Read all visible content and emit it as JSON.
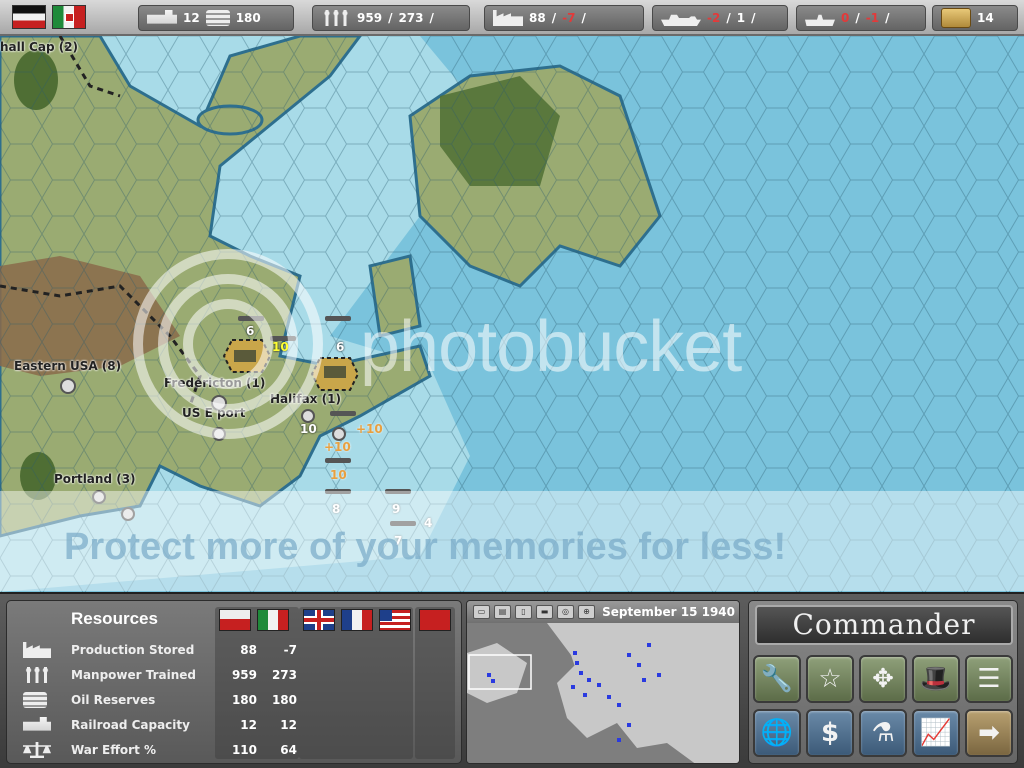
{
  "topbar": {
    "rail": "12",
    "oil": "180",
    "manpower": "959",
    "manpower_sep": "/",
    "manpower2": "273",
    "manpower_sep2": "/",
    "production": "88",
    "production_sep": "/",
    "production_delta": "-7",
    "production_sep2": "/",
    "naval": "-2",
    "naval_sep": "/",
    "naval2": "1",
    "naval_sep2": "/",
    "sub": "0",
    "sub_sep": "/",
    "sub2": "-1",
    "sub_sep2": "/",
    "treasure": "14",
    "icons": [
      "train-icon",
      "oil-barrels-icon",
      "manpower-icon",
      "factory-icon",
      "battleship-icon",
      "submarine-icon",
      "treasure-chest-icon"
    ]
  },
  "map": {
    "labels": [
      {
        "id": "hall-cap",
        "text": "hall Cap (2)"
      },
      {
        "id": "eastern-usa",
        "text": "Eastern USA (8)"
      },
      {
        "id": "fredericton",
        "text": "Fredericton (1)"
      },
      {
        "id": "us-east",
        "text": "US E port"
      },
      {
        "id": "halifax",
        "text": "Halifax (1)"
      },
      {
        "id": "portland",
        "text": "Portland (3)"
      }
    ],
    "unit_numbers": [
      "6",
      "10",
      "6",
      "10",
      "10",
      "+10",
      "+10",
      "8",
      "9",
      "4",
      "7"
    ],
    "watermark_logo": "photobucket",
    "watermark_text": "Protect more of your memories for less!"
  },
  "resources": {
    "title": "Resources",
    "rows": [
      {
        "label": "Production Stored",
        "v1": "88",
        "v2": "-7",
        "icon": "factory-icon"
      },
      {
        "label": "Manpower Trained",
        "v1": "959",
        "v2": "273",
        "icon": "manpower-icon"
      },
      {
        "label": "Oil Reserves",
        "v1": "180",
        "v2": "180",
        "icon": "oil-barrels-icon"
      },
      {
        "label": "Railroad Capacity",
        "v1": "12",
        "v2": "12",
        "icon": "train-icon"
      },
      {
        "label": "War Effort %",
        "v1": "110",
        "v2": "64",
        "icon": "scales-icon"
      }
    ],
    "flags": [
      "germany",
      "italy",
      "united-kingdom",
      "france",
      "united-states",
      "soviet-union"
    ]
  },
  "minimap": {
    "date": "September 15 1940",
    "tabs": [
      "map-tab",
      "list-tab",
      "unit-tab",
      "ship-tab",
      "target-tab",
      "zoom-tab"
    ]
  },
  "commander": {
    "title": "Commander",
    "buttons": [
      {
        "id": "repair",
        "icon": "wrench-icon",
        "glyph": "🔧"
      },
      {
        "id": "promote",
        "icon": "star-icon",
        "glyph": "☆"
      },
      {
        "id": "move",
        "icon": "move-arrows-icon",
        "glyph": "✥"
      },
      {
        "id": "diplomacy",
        "icon": "top-hat-icon",
        "glyph": "🎩"
      },
      {
        "id": "reports",
        "icon": "list-icon",
        "glyph": "☰"
      },
      {
        "id": "world",
        "icon": "globe-icon",
        "glyph": "🌐"
      },
      {
        "id": "economy",
        "icon": "dollar-icon",
        "glyph": "$"
      },
      {
        "id": "research",
        "icon": "flask-icon",
        "glyph": "⚗"
      },
      {
        "id": "statistics",
        "icon": "chart-icon",
        "glyph": "📈"
      },
      {
        "id": "end-turn",
        "icon": "arrow-right-icon",
        "glyph": "➡"
      }
    ]
  },
  "colors": {
    "sea": "#7ac3dc",
    "land": "#9aab72",
    "forest": "#4f6e34",
    "mountain": "#8a6a4a",
    "negative": "#e23a3a"
  }
}
